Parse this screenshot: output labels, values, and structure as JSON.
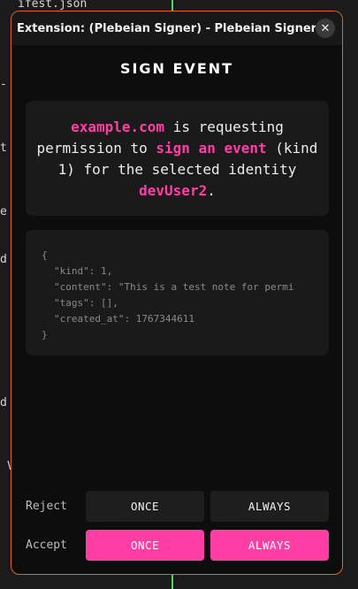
{
  "background": {
    "fragments": [
      "ifest.json",
      "-",
      "t",
      "e",
      "d",
      "d",
      "V"
    ]
  },
  "window": {
    "title": "Extension: (Plebeian Signer) - Plebeian Signer — ...",
    "close_glyph": "✕"
  },
  "heading": "SIGN EVENT",
  "request": {
    "domain": "example.com",
    "text1": " is requesting permission to ",
    "action": "sign an event",
    "text2": " (kind 1) for the selected identity ",
    "identity": "devUser2",
    "text3": "."
  },
  "event_json": {
    "open": "{",
    "lines": [
      "\"kind\": 1,",
      "\"content\": \"This is a test note for permi",
      "\"tags\": [],",
      "\"created_at\": 1767344611"
    ],
    "close": "}"
  },
  "actions": {
    "reject_label": "Reject",
    "accept_label": "Accept",
    "once": "ONCE",
    "always": "ALWAYS"
  },
  "colors": {
    "accent": "#ff3ea5",
    "window_border": "#e0632f",
    "bg": "#0d0d0d"
  }
}
